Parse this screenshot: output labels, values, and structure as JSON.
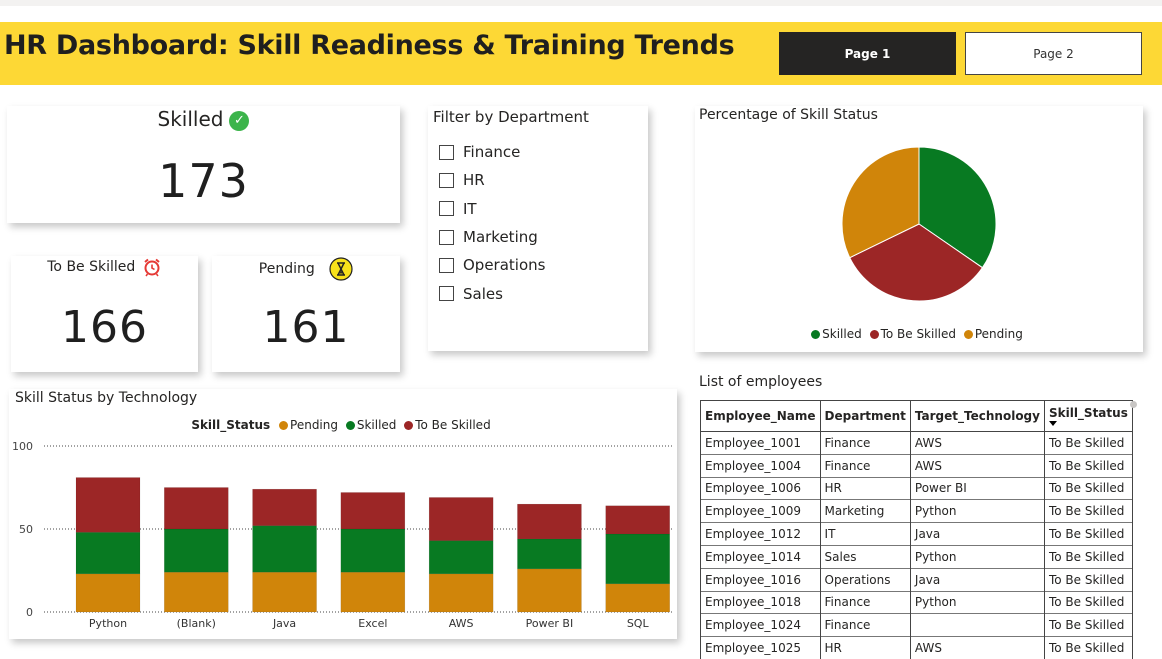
{
  "header": {
    "title": "HR Dashboard: Skill Readiness & Training Trends",
    "page1_label": "Page 1",
    "page2_label": "Page 2",
    "background": "#fdd835"
  },
  "kpis": {
    "skilled": {
      "label": "Skilled",
      "value": "173",
      "icon": "check-circle-icon"
    },
    "to_be_skilled": {
      "label": "To Be Skilled",
      "value": "166",
      "icon": "alarm-clock-icon"
    },
    "pending": {
      "label": "Pending",
      "value": "161",
      "icon": "hourglass-icon"
    }
  },
  "filter": {
    "title": "Filter by Department",
    "options": [
      "Finance",
      "HR",
      "IT",
      "Marketing",
      "Operations",
      "Sales"
    ]
  },
  "colors": {
    "pending": "#d0850a",
    "skilled": "#087a22",
    "to_be_skilled": "#9c2626"
  },
  "chart_data": [
    {
      "type": "pie",
      "title": "Percentage of Skill Status",
      "labels": [
        "Skilled",
        "To Be Skilled",
        "Pending"
      ],
      "values": [
        173,
        166,
        161
      ],
      "legend": "bottom-center"
    },
    {
      "type": "bar",
      "stacked": true,
      "title": "Skill Status by Technology",
      "legend_title": "Skill_Status",
      "legend": "top-center",
      "categories": [
        "Python",
        "(Blank)",
        "Java",
        "Excel",
        "AWS",
        "Power BI",
        "SQL"
      ],
      "series": [
        {
          "name": "Pending",
          "values": [
            23,
            24,
            24,
            24,
            23,
            26,
            17
          ]
        },
        {
          "name": "Skilled",
          "values": [
            25,
            26,
            28,
            26,
            20,
            18,
            30
          ]
        },
        {
          "name": "To Be Skilled",
          "values": [
            33,
            25,
            22,
            22,
            26,
            21,
            17
          ]
        }
      ],
      "yticks": [
        0,
        50,
        100
      ],
      "ylim": [
        0,
        100
      ],
      "grid": true
    }
  ],
  "table": {
    "title": "List of employees",
    "columns": [
      "Employee_Name",
      "Department",
      "Target_Technology",
      "Skill_Status"
    ],
    "rows": [
      [
        "Employee_1001",
        "Finance",
        "AWS",
        "To Be Skilled"
      ],
      [
        "Employee_1004",
        "Finance",
        "AWS",
        "To Be Skilled"
      ],
      [
        "Employee_1006",
        "HR",
        "Power BI",
        "To Be Skilled"
      ],
      [
        "Employee_1009",
        "Marketing",
        "Python",
        "To Be Skilled"
      ],
      [
        "Employee_1012",
        "IT",
        "Java",
        "To Be Skilled"
      ],
      [
        "Employee_1014",
        "Sales",
        "Python",
        "To Be Skilled"
      ],
      [
        "Employee_1016",
        "Operations",
        "Java",
        "To Be Skilled"
      ],
      [
        "Employee_1018",
        "Finance",
        "Python",
        "To Be Skilled"
      ],
      [
        "Employee_1024",
        "Finance",
        "",
        "To Be Skilled"
      ],
      [
        "Employee_1025",
        "HR",
        "AWS",
        "To Be Skilled"
      ]
    ]
  }
}
